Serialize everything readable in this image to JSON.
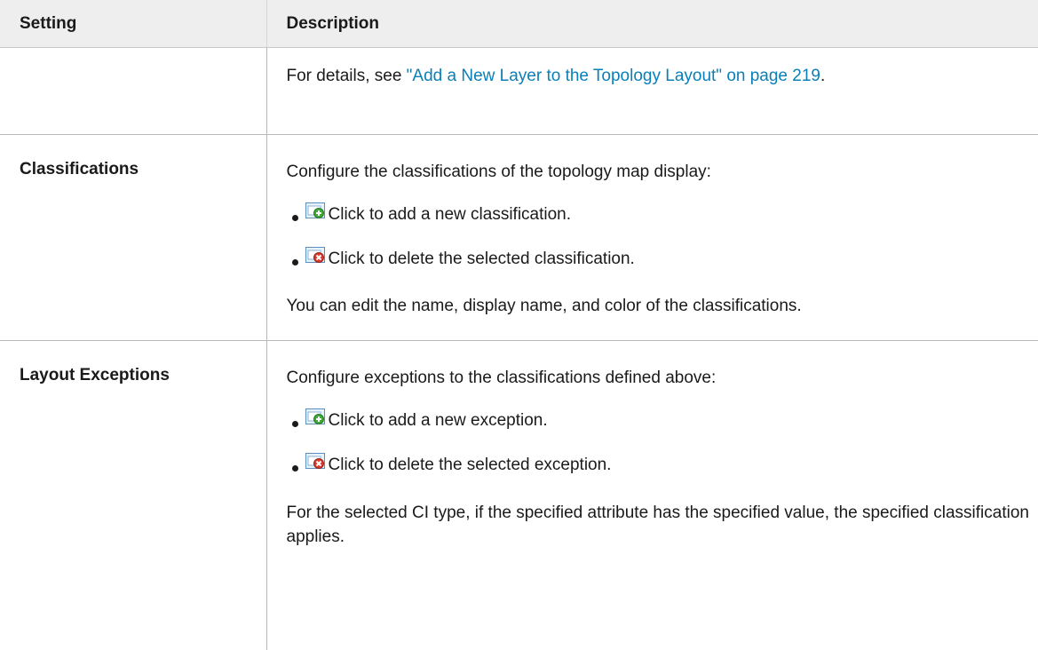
{
  "table": {
    "headers": [
      "Setting",
      "Description"
    ],
    "row_top": {
      "text_before": "For details, see ",
      "link_text": "\"Add a New Layer to the Topology Layout\" on page 219",
      "text_after": "."
    },
    "row_classifications": {
      "setting": "Classifications",
      "intro": "Configure the classifications of the topology map display:",
      "items": [
        {
          "icon": "add-icon",
          "text": "Click to add a new classification."
        },
        {
          "icon": "delete-icon",
          "text": "Click to delete the selected classification."
        }
      ],
      "note": "You can edit the name, display name, and color of the classifications."
    },
    "row_layout_exceptions": {
      "setting": "Layout Exceptions",
      "intro": "Configure exceptions to the classifications defined above:",
      "items": [
        {
          "icon": "add-icon",
          "text": "Click to add a new exception."
        },
        {
          "icon": "delete-icon",
          "text": "Click to delete the selected exception."
        }
      ],
      "note": "For the selected CI type, if the specified attribute has the specified value, the specified classification applies."
    }
  },
  "colors": {
    "link": "#0a7fb8",
    "header_bg": "#eeeeee",
    "border": "#b9b9b9"
  }
}
